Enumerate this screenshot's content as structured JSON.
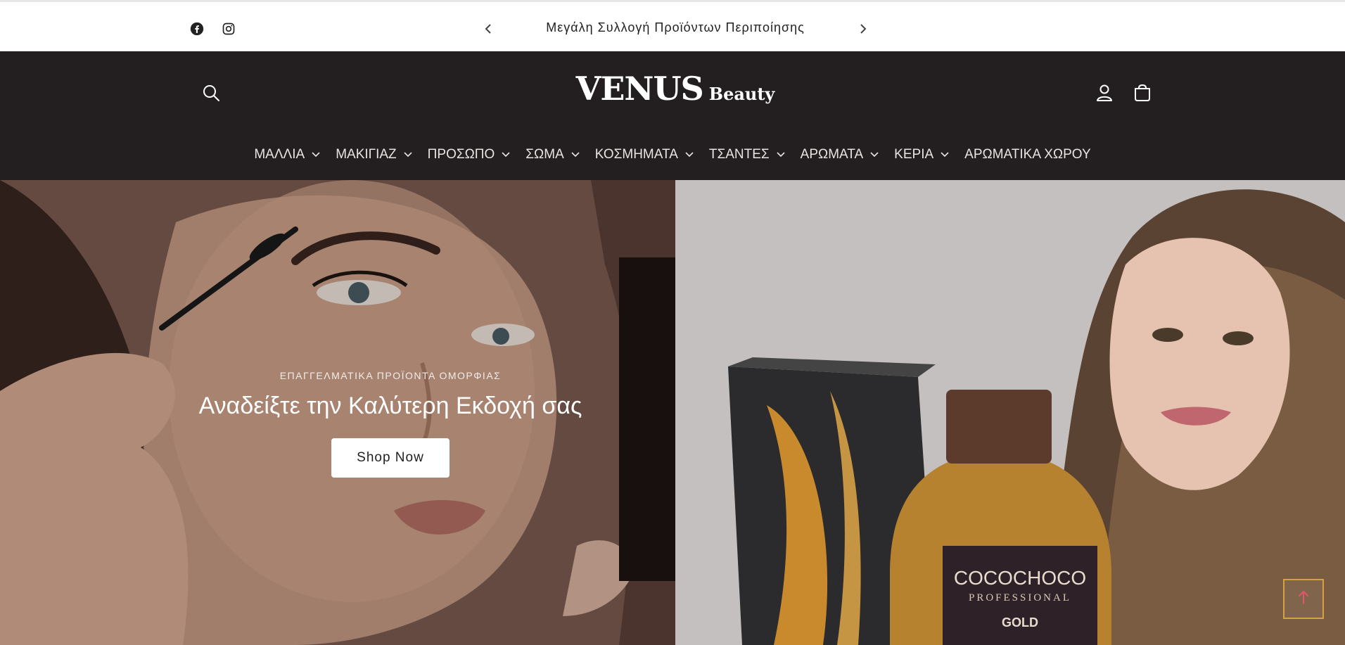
{
  "announcement": {
    "text": "Μεγάλη Συλλογή Προϊόντων Περιποίησης",
    "social": [
      "facebook-icon",
      "instagram-icon"
    ],
    "controls": [
      "chevron-left-icon",
      "chevron-right-icon"
    ]
  },
  "header": {
    "logo_main": "VENUS",
    "logo_sub": "Beauty",
    "icons": [
      "search-icon",
      "account-icon",
      "cart-icon"
    ],
    "nav": [
      {
        "label": "ΜΑΛΛΙΑ",
        "dropdown": true
      },
      {
        "label": "ΜΑΚΙΓΙΑΖ",
        "dropdown": true
      },
      {
        "label": "ΠΡΟΣΩΠΟ",
        "dropdown": true
      },
      {
        "label": "ΣΩΜΑ",
        "dropdown": true
      },
      {
        "label": "ΚΟΣΜΗΜΑΤΑ",
        "dropdown": true
      },
      {
        "label": "ΤΣΑΝΤΕΣ",
        "dropdown": true
      },
      {
        "label": "ΑΡΩΜΑΤΑ",
        "dropdown": true
      },
      {
        "label": "ΚΕΡΙΑ",
        "dropdown": true
      },
      {
        "label": "ΑΡΩΜΑΤΙΚΑ ΧΩΡΟΥ",
        "dropdown": false
      }
    ]
  },
  "hero": {
    "eyebrow": "ΕΠΑΓΓΕΛΜΑΤΙΚΑ ΠΡΟΪΟΝΤΑ ΟΜΟΡΦΙΑΣ",
    "title": "Αναδείξτε την Καλύτερη Εκδοχή σας",
    "button_label": "Shop Now",
    "product_brand": "COCOCHOCO",
    "product_line": "PROFESSIONAL",
    "product_name": "GOLD"
  },
  "colors": {
    "header_bg": "#231f20",
    "accent_scroll": "#d6a23f",
    "scroll_arrow": "#e0566a"
  }
}
